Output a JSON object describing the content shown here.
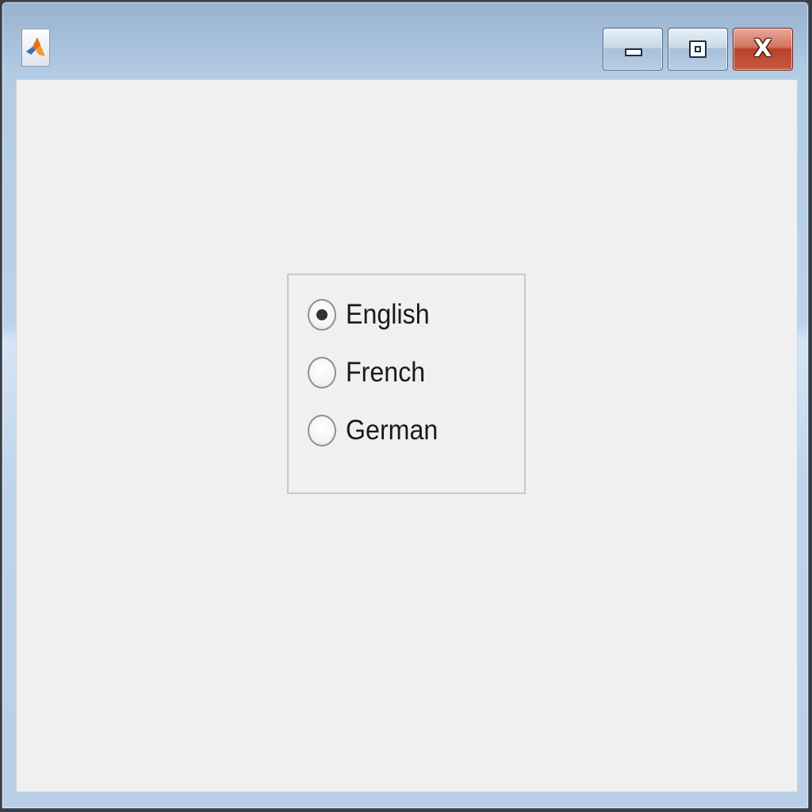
{
  "window": {
    "title": "",
    "app_icon": "matlab-icon",
    "controls": [
      {
        "name": "minimize",
        "icon": "minimize-icon"
      },
      {
        "name": "maximize",
        "icon": "maximize-icon"
      },
      {
        "name": "close",
        "icon": "close-icon",
        "glyph": "X"
      }
    ],
    "colors": {
      "frame": "#b9cfe7",
      "client_background": "#f0f0f0",
      "close_button": "#c84a32",
      "group_border": "#c8c8c8"
    }
  },
  "language_group": {
    "options": [
      {
        "label": "English",
        "selected": true
      },
      {
        "label": "French",
        "selected": false
      },
      {
        "label": "German",
        "selected": false
      }
    ]
  }
}
